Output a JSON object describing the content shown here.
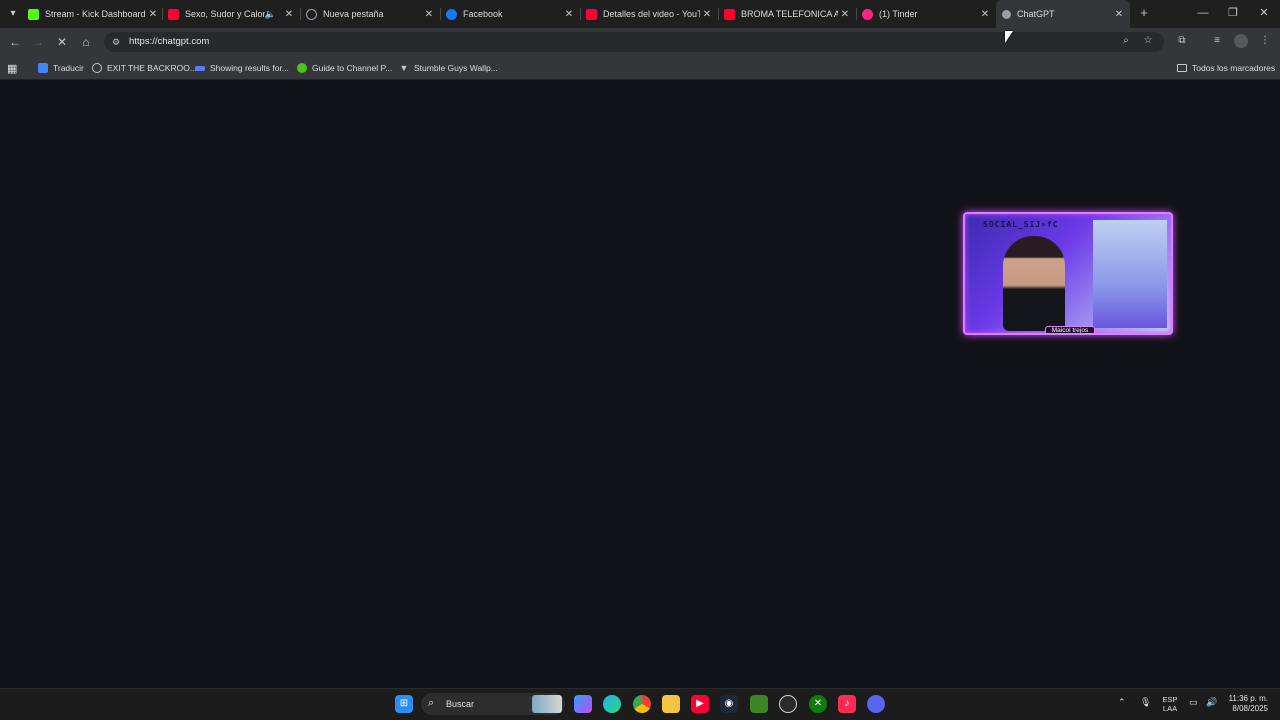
{
  "browser": {
    "tabs": [
      {
        "title": "Stream - Kick Dashboard",
        "favicon": "kick-icon",
        "color": "#53fc18"
      },
      {
        "title": "Sexo, Sudor y Calor -",
        "favicon": "youtube-icon",
        "color": "#ff0033",
        "audio": true
      },
      {
        "title": "Nueva pestaña",
        "favicon": "chrome-newtab-icon",
        "color": "#9aa0a6"
      },
      {
        "title": "Facebook",
        "favicon": "facebook-icon",
        "color": "#1877f2"
      },
      {
        "title": "Detalles del video - YouTu",
        "favicon": "youtube-studio-icon",
        "color": "#ff0033"
      },
      {
        "title": "BROMA TELEFONICA A M",
        "favicon": "youtube-icon",
        "color": "#ff0033"
      },
      {
        "title": "(1) Tinder",
        "favicon": "tinder-icon",
        "color": "#fd267a"
      },
      {
        "title": "ChatGPT",
        "favicon": "chatgpt-icon",
        "color": "#c7c7c7",
        "active": true
      }
    ],
    "address": {
      "url": "https://chatgpt.com"
    },
    "bookmarks": [
      {
        "label": "Traducir",
        "icon": "translate-icon",
        "color": "#4285f4"
      },
      {
        "label": "EXIT THE BACKROO...",
        "icon": "globe-icon",
        "color": "#c7c7c7"
      },
      {
        "label": "Showing results for...",
        "icon": "bookmark-site-icon",
        "color": "#5b7bff"
      },
      {
        "label": "Guide to Channel P...",
        "icon": "xbox-icon",
        "color": "#4cc21b"
      },
      {
        "label": "Stumble Guys Wallp...",
        "icon": "bookmark-arrow-icon",
        "color": "#c7c7c7"
      }
    ],
    "all_bookmarks_label": "Todos los marcadores"
  },
  "webcam": {
    "banner_text": "SOCIAL_SIJ»fC",
    "name_tag": "Maicol trejos"
  },
  "taskbar": {
    "search_placeholder": "Buscar",
    "language": {
      "line1": "ESP",
      "line2": "LAA"
    },
    "clock": {
      "time": "11:36 p. m.",
      "date": "8/08/2025"
    },
    "icons": [
      "windows-start-icon",
      "search-icon",
      "copilot-icon",
      "edge-icon",
      "chrome-icon",
      "file-explorer-icon",
      "youtube-icon",
      "steam-icon",
      "minecraft-icon",
      "chrome-alt-icon",
      "xbox-icon",
      "tiktok-icon",
      "discord-icon"
    ]
  }
}
